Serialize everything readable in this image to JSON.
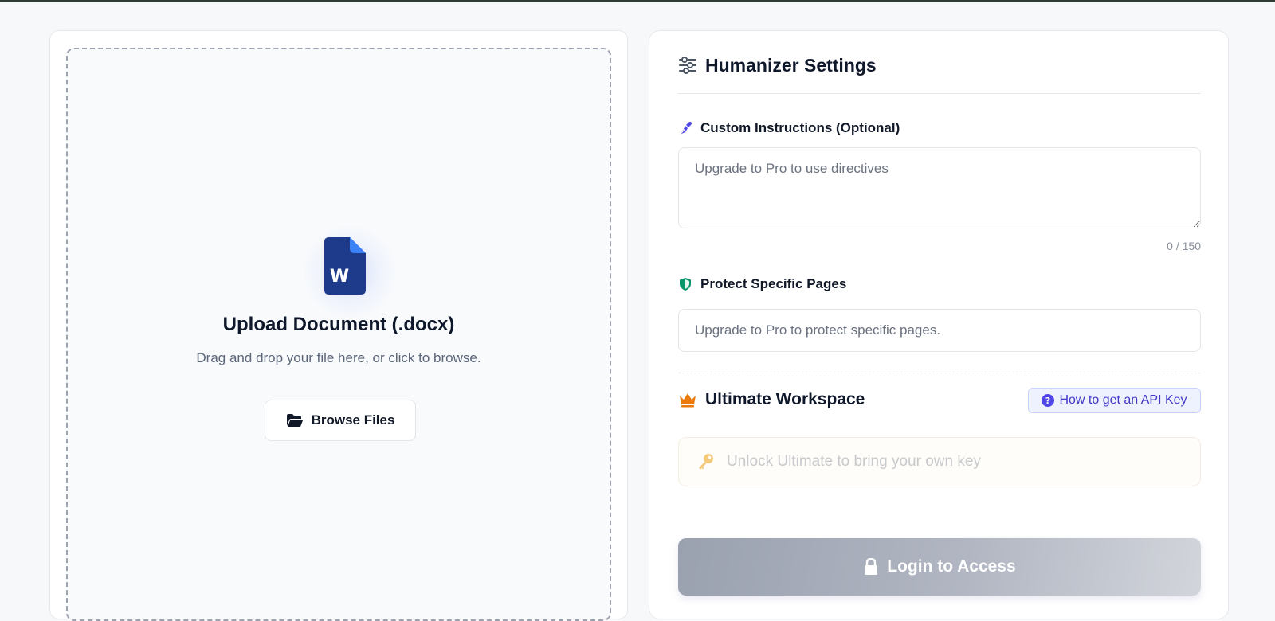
{
  "upload": {
    "title": "Upload Document (.docx)",
    "subtitle": "Drag and drop your file here, or click to browse.",
    "browse_label": "Browse Files",
    "doc_icon_letter": "W"
  },
  "settings": {
    "title": "Humanizer Settings",
    "instructions": {
      "label": "Custom Instructions (Optional)",
      "placeholder": "Upgrade to Pro to use directives",
      "char_count": "0 / 150"
    },
    "protect": {
      "label": "Protect Specific Pages",
      "placeholder": "Upgrade to Pro to protect specific pages."
    },
    "ultimate": {
      "title": "Ultimate Workspace",
      "api_link_label": "How to get an API Key",
      "key_placeholder": "Unlock Ultimate to bring your own key"
    },
    "login_label": "Login to Access"
  },
  "icons": {
    "doc": "word-document-icon",
    "browse": "folder-open-icon",
    "settings": "sliders-icon",
    "instructions": "pen-nib-icon",
    "protect": "shield-icon",
    "ultimate": "crown-icon",
    "api": "question-circle-icon",
    "key": "key-icon",
    "login": "lock-icon"
  },
  "colors": {
    "accent_purple": "#4f46e5",
    "shield_green": "#059669",
    "crown_orange": "#ea7a0c",
    "doc_blue": "#1e3a8a",
    "key_yellow": "#f5c97a",
    "login_gray": "#a5abb8"
  }
}
